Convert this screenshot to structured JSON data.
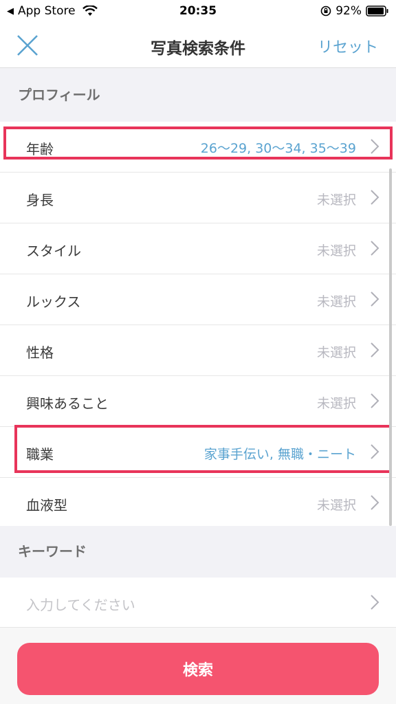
{
  "status_bar": {
    "back_app": "App Store",
    "time": "20:35",
    "battery": "92%"
  },
  "nav": {
    "title": "写真検索条件",
    "reset_label": "リセット"
  },
  "sections": {
    "profile": "プロフィール",
    "keyword": "キーワード"
  },
  "profile_rows": [
    {
      "label": "年齢",
      "value": "26〜29,  30〜34,  35〜39",
      "selected": true
    },
    {
      "label": "身長",
      "value": "未選択",
      "selected": false
    },
    {
      "label": "スタイル",
      "value": "未選択",
      "selected": false
    },
    {
      "label": "ルックス",
      "value": "未選択",
      "selected": false
    },
    {
      "label": "性格",
      "value": "未選択",
      "selected": false
    },
    {
      "label": "興味あること",
      "value": "未選択",
      "selected": false
    },
    {
      "label": "職業",
      "value": "家事手伝い,  無職・ニート",
      "selected": true
    },
    {
      "label": "血液型",
      "value": "未選択",
      "selected": false
    }
  ],
  "keyword": {
    "placeholder": "入力してください"
  },
  "search_button_label": "検索",
  "colors": {
    "accent_blue": "#5aa3d0",
    "highlight_red": "#e8345a",
    "button_pink": "#f5546f"
  }
}
